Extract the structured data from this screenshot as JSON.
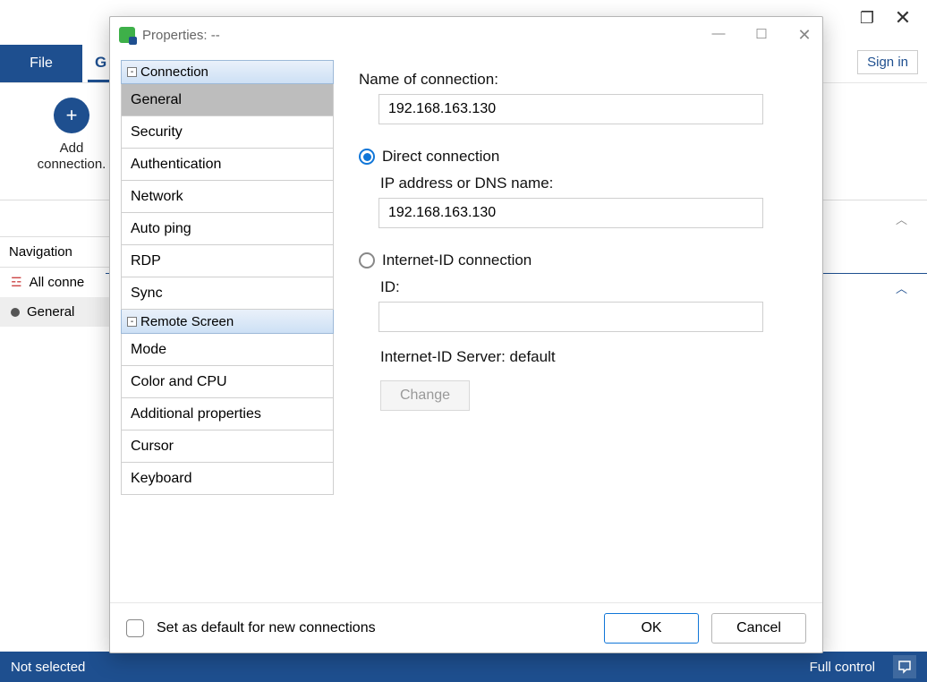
{
  "mainwin": {
    "file_label": "File",
    "tab_g": "G",
    "signin": "Sign in",
    "add_label_1": "Add",
    "add_label_2": "connection."
  },
  "nav": {
    "header": "Navigation",
    "item_all": "All conne",
    "item_general": "General"
  },
  "status": {
    "left": "Not selected",
    "right": "Full control"
  },
  "dialog": {
    "title": "Properties: --",
    "tree": {
      "group1": "Connection",
      "items1": [
        "General",
        "Security",
        "Authentication",
        "Network",
        "Auto ping",
        "RDP",
        "Sync"
      ],
      "group2": "Remote Screen",
      "items2": [
        "Mode",
        "Color and CPU",
        "Additional properties",
        "Cursor",
        "Keyboard"
      ]
    },
    "form": {
      "name_label": "Name of connection:",
      "name_value": "192.168.163.130",
      "direct_label": "Direct connection",
      "ip_label": "IP address or DNS name:",
      "ip_value": "192.168.163.130",
      "inet_label": "Internet-ID connection",
      "id_label": "ID:",
      "id_value": "",
      "server_label": "Internet-ID Server: default",
      "change_label": "Change"
    },
    "footer": {
      "default_label": "Set as default for new connections",
      "ok": "OK",
      "cancel": "Cancel"
    }
  }
}
